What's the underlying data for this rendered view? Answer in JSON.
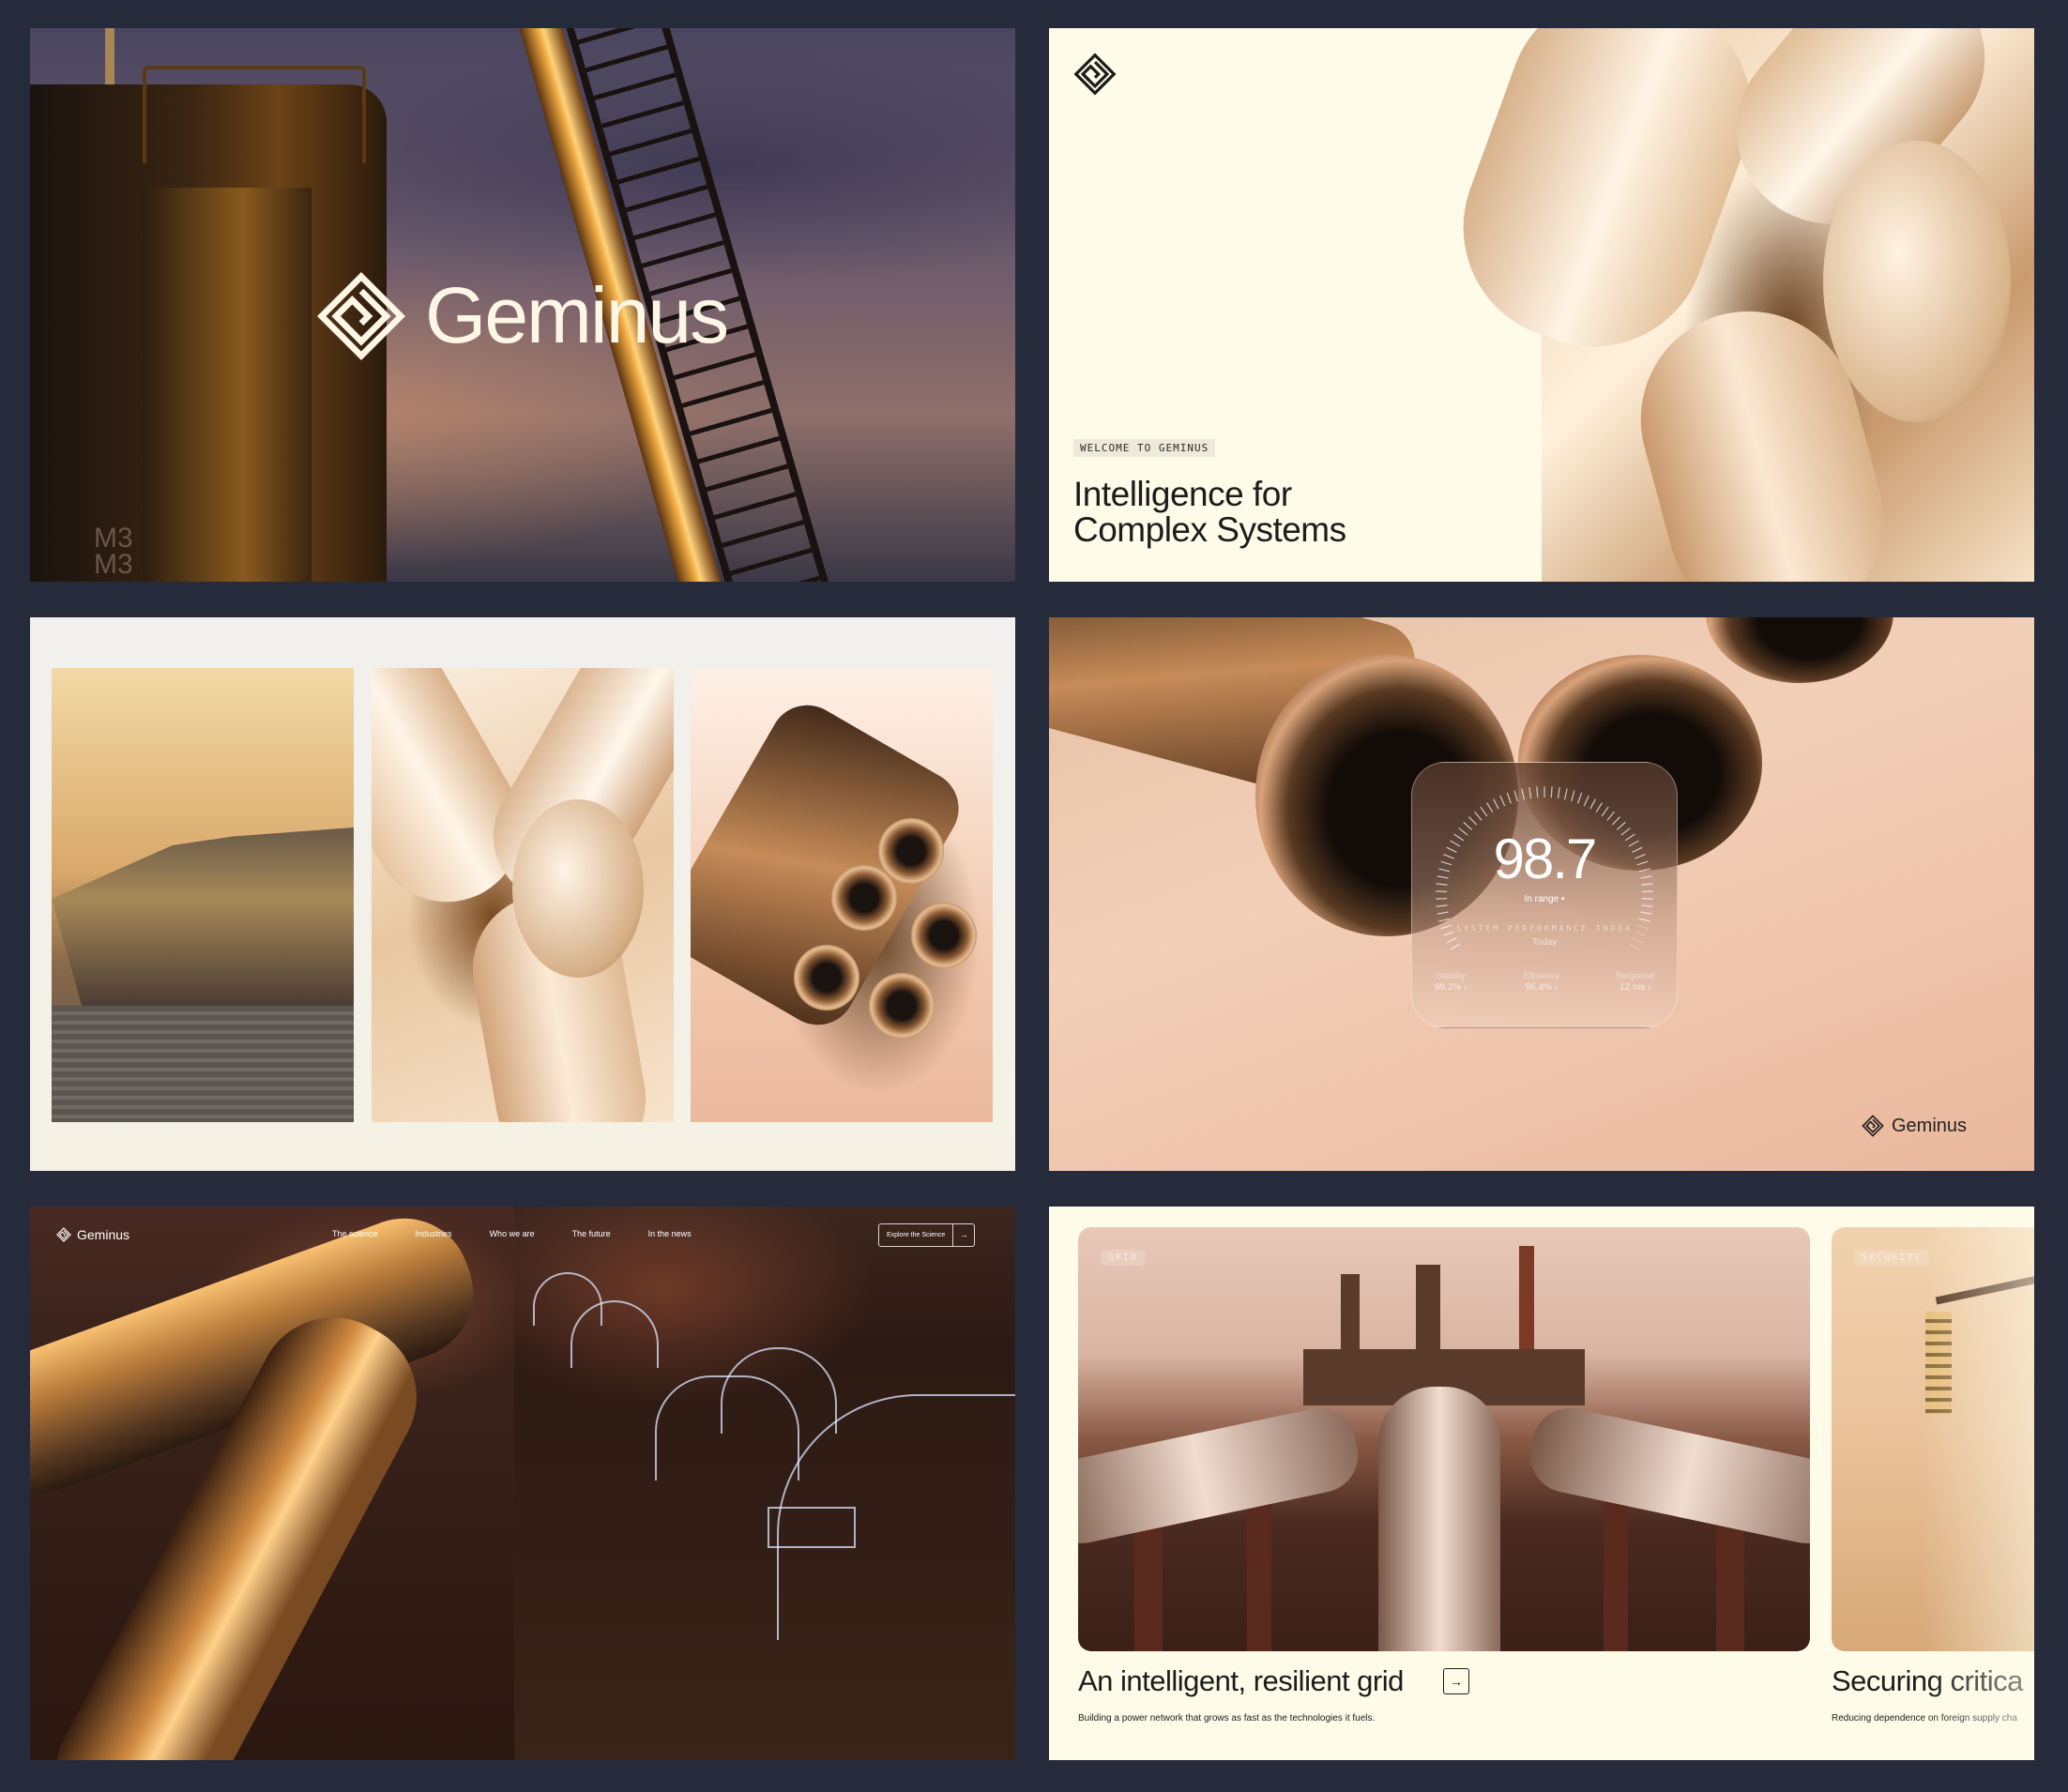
{
  "brand": {
    "name": "Geminus",
    "icon": "geminus-logo-icon"
  },
  "hero": {
    "wordmark": "Geminus",
    "tower_marking": "M3\nM3"
  },
  "welcome": {
    "eyebrow": "WELCOME TO GEMINUS",
    "headline_line1": "Intelligence for",
    "headline_line2": "Complex Systems"
  },
  "performance": {
    "score": "98.7",
    "status": "In range •",
    "label": "SYSTEM PERFORMANCE INDEX",
    "period": "Today",
    "metrics": [
      {
        "label": "Stability",
        "value": "99.2% ›"
      },
      {
        "label": "Efficiency",
        "value": "96.4% ›"
      },
      {
        "label": "Response",
        "value": "12 ms ›"
      }
    ],
    "brand_word": "Geminus"
  },
  "site": {
    "brand_word": "Geminus",
    "nav": [
      "The science",
      "Industries",
      "Who we are",
      "The future",
      "In the news"
    ],
    "cta_label": "Explore the Science",
    "cta_arrow": "→"
  },
  "cards": [
    {
      "chip": "GRID",
      "title": "An intelligent, resilient grid",
      "desc": "Building a power network that grows as fast as the technologies it fuels.",
      "arrow": "→"
    },
    {
      "chip": "SECURITY",
      "title": "Securing critica",
      "desc": "Reducing dependence on foreign supply cha"
    }
  ],
  "colors": {
    "page_bg": "#262b3c",
    "cream": "#fefbe8",
    "ink": "#1c1c1c",
    "copper": "#e8a23c"
  }
}
